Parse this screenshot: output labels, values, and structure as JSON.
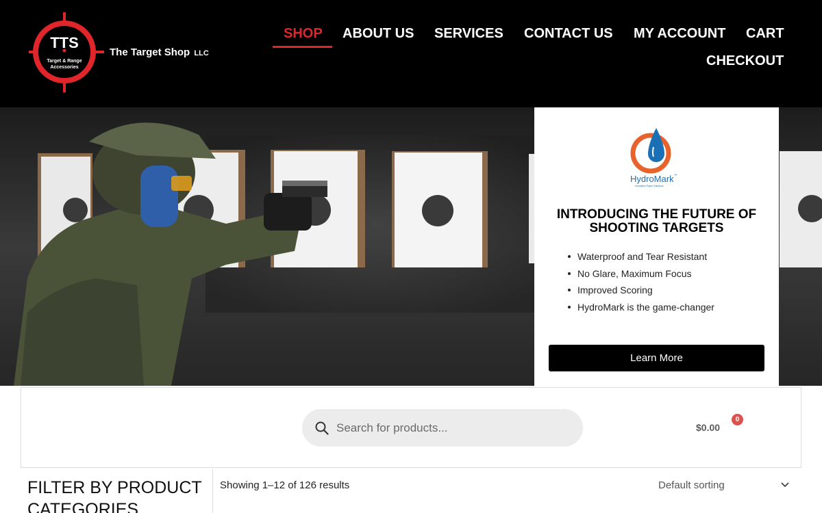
{
  "brand": {
    "logo_letters": "TTS",
    "logo_subtitle_line1": "Target & Range",
    "logo_subtitle_line2": "Accessories",
    "name": "The Target Shop",
    "suffix": "LLC"
  },
  "nav": {
    "items": [
      {
        "label": "SHOP",
        "active": true
      },
      {
        "label": "ABOUT US",
        "active": false
      },
      {
        "label": "SERVICES",
        "active": false
      },
      {
        "label": "CONTACT US",
        "active": false
      },
      {
        "label": "MY ACCOUNT",
        "active": false
      },
      {
        "label": "CART",
        "active": false
      },
      {
        "label": "CHECKOUT",
        "active": false
      }
    ]
  },
  "promo": {
    "logo_name": "HydroMark",
    "logo_tm": "™",
    "logo_tagline": "Innovative Paper Solutions",
    "title": "INTRODUCING THE FUTURE OF SHOOTING TARGETS",
    "features": [
      "Waterproof and Tear Resistant",
      "No Glare, Maximum Focus",
      "Improved Scoring",
      "HydroMark is the game-changer"
    ],
    "button_label": "Learn More"
  },
  "search": {
    "placeholder": "Search for products...",
    "icon": "search-icon"
  },
  "cart": {
    "total": "$0.00",
    "count": "0"
  },
  "sidebar": {
    "heading": "FILTER BY PRODUCT CATEGORIES"
  },
  "products": {
    "results_text": "Showing 1–12 of 126 results",
    "sort_selected": "Default sorting"
  },
  "colors": {
    "accent": "#e0262b",
    "header_bg": "#000000",
    "badge": "#d9534f",
    "hydromark_blue": "#1b6fb5",
    "hydromark_orange": "#e8622c"
  }
}
